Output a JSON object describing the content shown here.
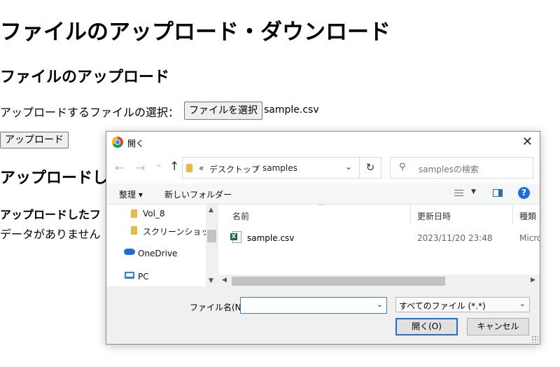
{
  "page": {
    "title": "ファイルのアップロード・ダウンロード",
    "upload_heading": "ファイルのアップロード",
    "select_label": "アップロードするファイルの選択：",
    "choose_file_button": "ファイルを選択",
    "chosen_file": "sample.csv",
    "upload_button": "アップロード",
    "uploaded_heading": "アップロードし",
    "uploaded_subheading": "アップロードしたフ",
    "no_data": "データがありません"
  },
  "dialog": {
    "title": "開く",
    "close_glyph": "✕",
    "nav": {
      "back": "←",
      "forward": "→",
      "recent": "⌄",
      "up": "↑",
      "breadcrumb_prefix": "«",
      "breadcrumb": [
        "デスクトップ",
        "samples"
      ],
      "crumb_sep": "›",
      "dropdown": "⌄",
      "refresh": "↻",
      "search_placeholder": "samplesの検索",
      "search_glyph": "⚲"
    },
    "toolbar": {
      "organize": "整理 ▾",
      "new_folder": "新しいフォルダー",
      "view_chevron": "▼",
      "help": "?"
    },
    "tree": [
      {
        "label": "Vol_8",
        "icon": "folder-icon"
      },
      {
        "label": "スクリーンショット",
        "icon": "folder-icon"
      },
      {
        "label": "OneDrive",
        "icon": "onedrive-icon"
      },
      {
        "label": "PC",
        "icon": "pc-icon"
      }
    ],
    "scroll": {
      "up": "▲",
      "down": "▼",
      "left": "◀",
      "right": "▶"
    },
    "columns": {
      "name": "名前",
      "modified": "更新日時",
      "type": "種類",
      "sort_caret": "^"
    },
    "files": [
      {
        "name": "sample.csv",
        "modified": "2023/11/20 23:48",
        "type": "Micro"
      }
    ],
    "filename_label": "ファイル名(N):",
    "filename_value": "",
    "filetype_value": "すべてのファイル (*.*)",
    "open_button": "開く(O)",
    "cancel_button": "キャンセル",
    "combo_chevron": "⌄"
  }
}
